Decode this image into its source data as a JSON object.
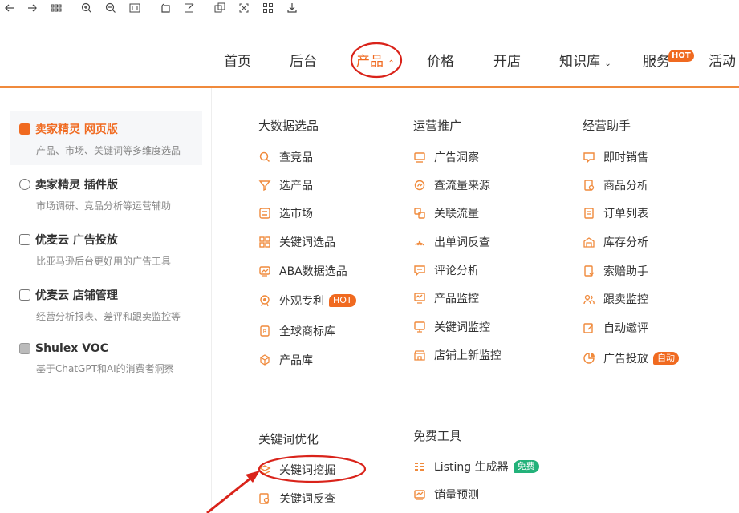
{
  "nav": {
    "items": [
      "首页",
      "后台",
      "产品",
      "价格",
      "开店",
      "知识库",
      "服务",
      "活动"
    ],
    "hot": "HOT",
    "accent": "#f06a20"
  },
  "sidebar": {
    "items": [
      {
        "title": "卖家精灵 网页版",
        "sub": "产品、市场、关键词等多维度选品"
      },
      {
        "title": "卖家精灵 插件版",
        "sub": "市场调研、竞品分析等运营辅助"
      },
      {
        "title": "优麦云 广告投放",
        "sub": "比亚马逊后台更好用的广告工具"
      },
      {
        "title": "优麦云 店铺管理",
        "sub": "经营分析报表、差评和跟卖监控等"
      },
      {
        "title": "Shulex VOC",
        "sub": "基于ChatGPT和AI的消费者洞察"
      }
    ]
  },
  "columns": {
    "bigdata": {
      "head": "大数据选品",
      "links": [
        "查竞品",
        "选产品",
        "选市场",
        "关键词选品",
        "ABA数据选品",
        "外观专利",
        "全球商标库",
        "产品库"
      ]
    },
    "ops": {
      "head": "运营推广",
      "links": [
        "广告洞察",
        "查流量来源",
        "关联流量",
        "出单词反查",
        "评论分析",
        "产品监控",
        "关键词监控",
        "店铺上新监控"
      ]
    },
    "assistant": {
      "head": "经营助手",
      "links": [
        "即时销售",
        "商品分析",
        "订单列表",
        "库存分析",
        "索赔助手",
        "跟卖监控",
        "自动邀评",
        "广告投放"
      ]
    },
    "keyword": {
      "head": "关键词优化",
      "links": [
        "关键词挖掘",
        "关键词反查"
      ]
    },
    "free": {
      "head": "免费工具",
      "links": [
        "Listing 生成器",
        "销量预测"
      ]
    }
  },
  "tags": {
    "hot": "HOT",
    "auto": "自动",
    "free": "免费"
  }
}
